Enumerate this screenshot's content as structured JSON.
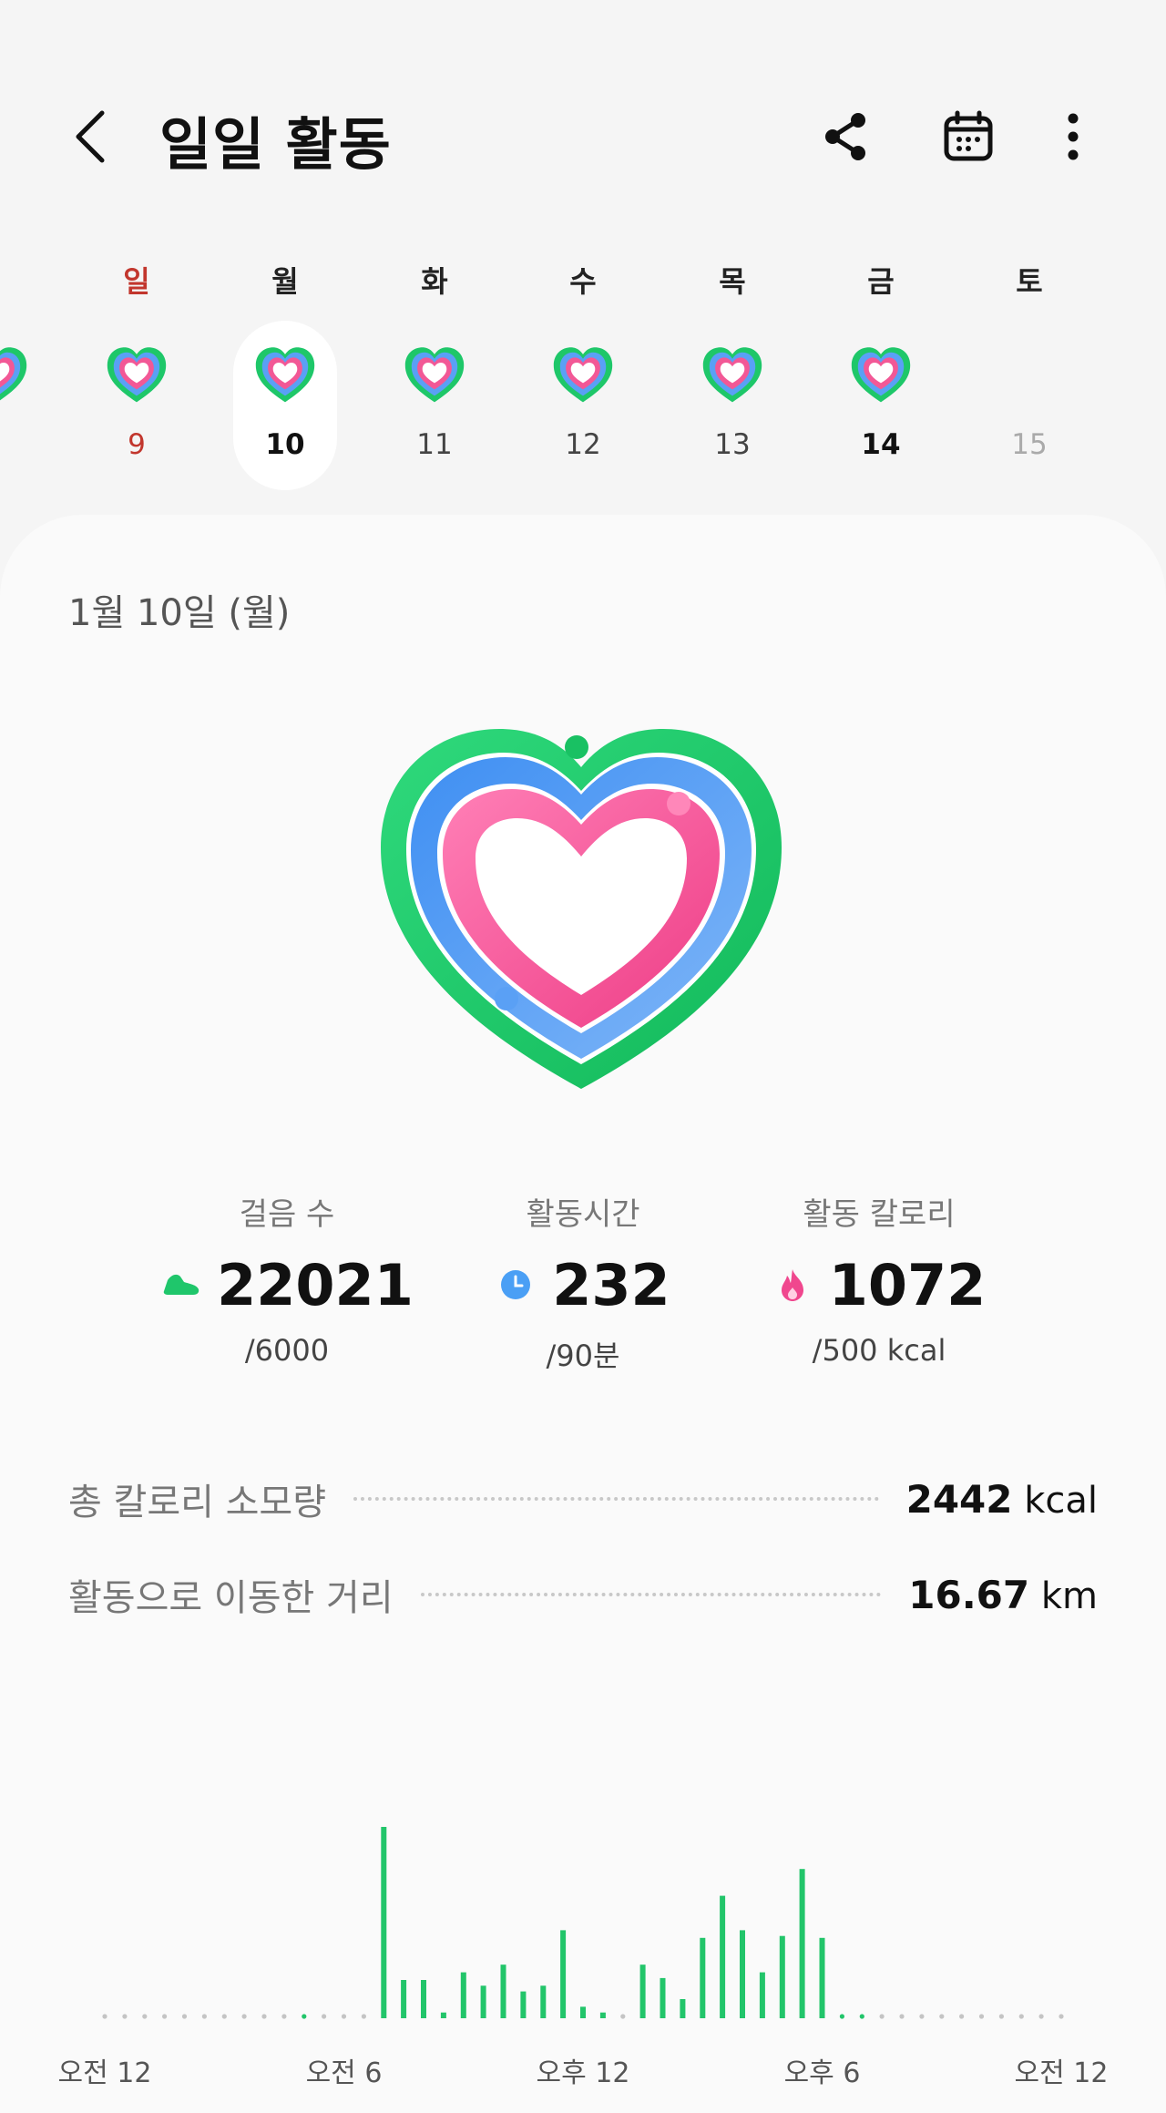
{
  "header": {
    "title": "일일 활동",
    "back_icon": "chevron-left-icon",
    "share_icon": "share-icon",
    "calendar_icon": "calendar-icon",
    "more_icon": "more-vertical-icon"
  },
  "week": {
    "days": [
      {
        "label": "일",
        "num": "9",
        "has_heart": true,
        "sunday": true
      },
      {
        "label": "월",
        "num": "10",
        "has_heart": true,
        "selected": true
      },
      {
        "label": "화",
        "num": "11",
        "has_heart": true
      },
      {
        "label": "수",
        "num": "12",
        "has_heart": true
      },
      {
        "label": "목",
        "num": "13",
        "has_heart": true
      },
      {
        "label": "금",
        "num": "14",
        "has_heart": true,
        "bold": true
      },
      {
        "label": "토",
        "num": "15",
        "has_heart": false,
        "future": true
      }
    ]
  },
  "date_heading": "1월 10일 (월)",
  "stats": {
    "steps": {
      "label": "걸음 수",
      "value": "22021",
      "goal": "/6000",
      "icon": "shoe-icon",
      "color": "#1fc66b"
    },
    "active_time": {
      "label": "활동시간",
      "value": "232",
      "goal": "/90분",
      "icon": "clock-icon",
      "color": "#4a9ff5"
    },
    "active_calories": {
      "label": "활동 칼로리",
      "value": "1072",
      "goal": "/500 kcal",
      "icon": "flame-icon",
      "color": "#f0478e"
    }
  },
  "summary": {
    "total_calories": {
      "label": "총 칼로리 소모량",
      "value": "2442",
      "unit": "kcal"
    },
    "distance": {
      "label": "활동으로 이동한 거리",
      "value": "16.67",
      "unit": "km"
    }
  },
  "colors": {
    "green": "#1ec769",
    "blue": "#5aa0f5",
    "pink": "#f25896",
    "bar": "#22c56a"
  },
  "chart_data": {
    "type": "bar",
    "x_tick_labels": [
      "오전 12",
      "오전 6",
      "오후 12",
      "오후 6",
      "오전 12"
    ],
    "values": [
      0,
      0,
      0,
      0,
      0,
      0,
      0,
      0,
      0,
      0,
      0,
      0,
      0,
      0,
      0,
      0,
      0,
      0,
      0,
      0,
      0,
      0,
      0,
      0,
      0,
      0,
      0,
      0,
      0,
      0,
      0,
      0,
      0,
      0,
      0,
      0,
      0,
      0,
      0,
      0,
      0,
      0,
      0,
      0,
      0,
      0,
      0,
      0,
      0,
      0,
      0,
      0,
      0,
      0,
      0,
      0,
      0,
      0,
      0,
      0,
      0,
      0,
      0,
      0,
      0,
      0,
      0,
      0,
      0,
      0,
      0,
      0,
      0,
      0,
      0,
      0,
      0,
      0,
      0,
      0,
      0,
      0,
      0,
      0,
      0,
      0,
      0,
      0,
      0,
      0,
      0,
      0,
      0,
      0,
      0,
      0,
      0,
      0,
      0,
      0,
      0,
      0,
      0,
      0,
      0,
      0,
      0,
      0,
      0,
      0,
      0,
      0,
      0,
      0,
      0,
      0,
      0,
      0,
      0,
      0,
      0,
      0,
      0,
      0,
      0,
      0,
      0,
      0,
      0,
      0,
      0,
      0,
      0,
      0,
      0,
      0,
      0,
      0,
      0,
      0,
      0,
      0,
      0,
      0
    ],
    "bars": [
      {
        "slot": 10,
        "value": 1
      },
      {
        "slot": 14,
        "value": 100
      },
      {
        "slot": 15,
        "value": 20
      },
      {
        "slot": 16,
        "value": 20
      },
      {
        "slot": 17,
        "value": 3
      },
      {
        "slot": 18,
        "value": 24
      },
      {
        "slot": 19,
        "value": 17
      },
      {
        "slot": 20,
        "value": 28
      },
      {
        "slot": 21,
        "value": 14
      },
      {
        "slot": 22,
        "value": 17
      },
      {
        "slot": 23,
        "value": 46
      },
      {
        "slot": 24,
        "value": 6
      },
      {
        "slot": 25,
        "value": 3
      },
      {
        "slot": 27,
        "value": 28
      },
      {
        "slot": 28,
        "value": 21
      },
      {
        "slot": 29,
        "value": 10
      },
      {
        "slot": 30,
        "value": 42
      },
      {
        "slot": 31,
        "value": 64
      },
      {
        "slot": 32,
        "value": 46
      },
      {
        "slot": 33,
        "value": 24
      },
      {
        "slot": 34,
        "value": 43
      },
      {
        "slot": 35,
        "value": 78
      },
      {
        "slot": 36,
        "value": 42
      },
      {
        "slot": 37,
        "value": 1
      },
      {
        "slot": 38,
        "value": 2
      }
    ],
    "slots": 48,
    "ylim": [
      0,
      100
    ]
  }
}
